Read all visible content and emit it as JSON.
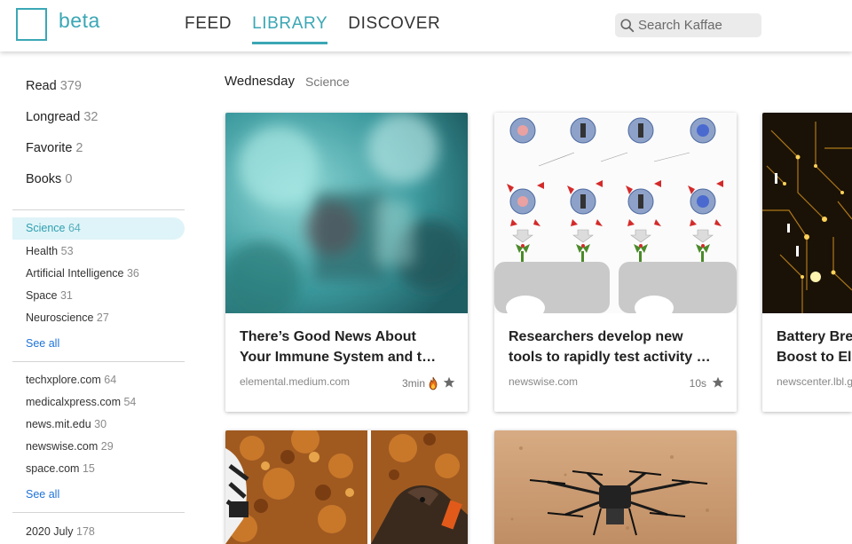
{
  "header": {
    "logo_text": "beta",
    "nav": [
      {
        "label": "FEED",
        "active": false
      },
      {
        "label": "LIBRARY",
        "active": true
      },
      {
        "label": "DISCOVER",
        "active": false
      }
    ],
    "search_placeholder": "Search Kaffae",
    "accent_color": "#3ba7b5"
  },
  "sidebar": {
    "main_items": [
      {
        "label": "Read",
        "count": "379"
      },
      {
        "label": "Longread",
        "count": "32"
      },
      {
        "label": "Favorite",
        "count": "2"
      },
      {
        "label": "Books",
        "count": "0"
      }
    ],
    "topics": [
      {
        "label": "Science",
        "count": "64",
        "active": true
      },
      {
        "label": "Health",
        "count": "53"
      },
      {
        "label": "Artificial Intelligence",
        "count": "36"
      },
      {
        "label": "Space",
        "count": "31"
      },
      {
        "label": "Neuroscience",
        "count": "27"
      }
    ],
    "topics_see_all": "See all",
    "sources": [
      {
        "label": "techxplore.com",
        "count": "64"
      },
      {
        "label": "medicalxpress.com",
        "count": "54"
      },
      {
        "label": "news.mit.edu",
        "count": "30"
      },
      {
        "label": "newswise.com",
        "count": "29"
      },
      {
        "label": "space.com",
        "count": "15"
      }
    ],
    "sources_see_all": "See all",
    "dates": [
      {
        "label": "2020 July",
        "count": "178"
      }
    ]
  },
  "main": {
    "heading": "Wednesday",
    "heading_tag": "Science",
    "cards": [
      {
        "title_line1": "There’s Good News About",
        "title_line2": "Your Immune System and t…",
        "source": "elemental.medium.com",
        "time": "3min",
        "hot": true,
        "image": "blurred-teal-abstract"
      },
      {
        "title_line1": "Researchers develop new",
        "title_line2": "tools to rapidly test activity …",
        "source": "newswise.com",
        "time": "10s",
        "hot": false,
        "image": "molecular-diagram"
      },
      {
        "title_line1": "Battery Bre",
        "title_line2": "Boost to El",
        "source": "newscenter.lbl.g",
        "time": "",
        "hot": false,
        "image": "golden-circuit"
      },
      {
        "image": "dogs-in-leaves"
      },
      {
        "image": "drone-on-sand"
      }
    ]
  }
}
